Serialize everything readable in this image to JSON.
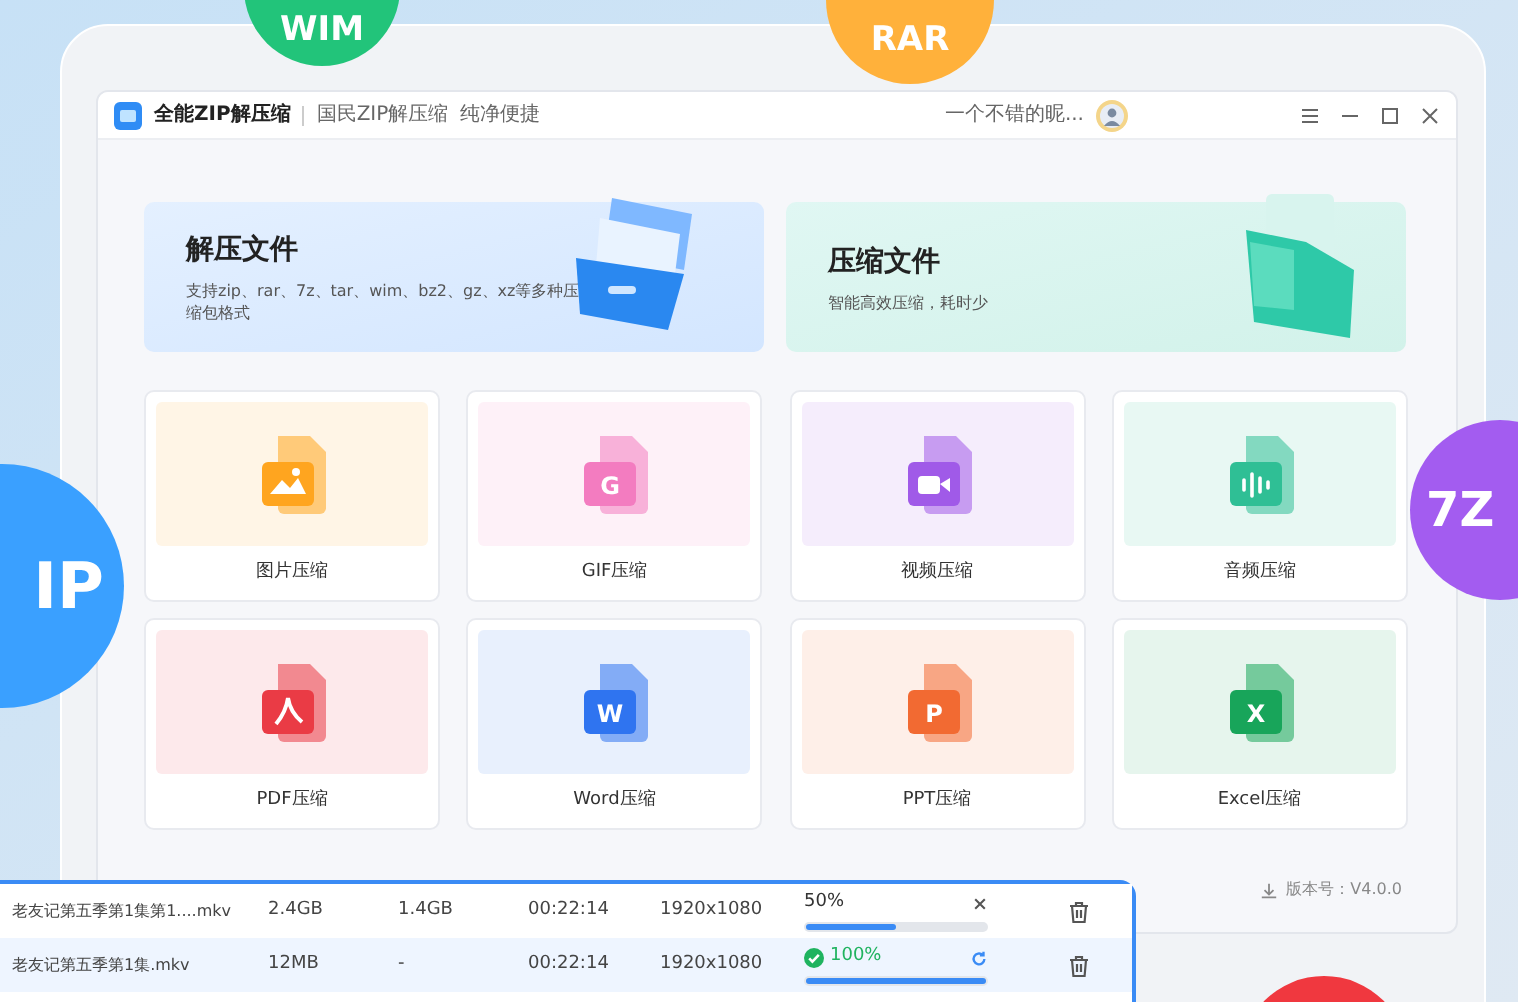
{
  "badges": [
    {
      "text": "WIM",
      "color": "#22c47a",
      "kind": "top_left"
    },
    {
      "text": "RAR",
      "color": "#ffb13b",
      "kind": "top_right"
    },
    {
      "text": "IP",
      "color": "#3aa0ff",
      "kind": "left"
    },
    {
      "text": "7Z",
      "color": "#a35cf0",
      "kind": "right"
    },
    {
      "color": "#f0383f",
      "kind": "bottom"
    }
  ],
  "window": {
    "app_name": "全能ZIP解压缩",
    "slogan": [
      "国民ZIP解压缩",
      "纯净便捷"
    ],
    "user_name": "一个不错的昵..."
  },
  "hero_cards": [
    {
      "kind": "extract",
      "title": "解压文件",
      "description": "支持zip、rar、7z、tar、wim、bz2、gz、xz等多种压缩包格式"
    },
    {
      "kind": "compress",
      "title": "压缩文件",
      "description": "智能高效压缩，耗时少"
    }
  ],
  "tools": [
    {
      "kind": "image",
      "label": "图片压缩",
      "color": "#ffa51f"
    },
    {
      "kind": "gif",
      "label": "GIF压缩",
      "glyph": "G",
      "color": "#f37cc0"
    },
    {
      "kind": "video",
      "label": "视频压缩",
      "color": "#a05ae8"
    },
    {
      "kind": "audio",
      "label": "音频压缩",
      "color": "#2fbf95"
    },
    {
      "kind": "pdf",
      "label": "PDF压缩",
      "color": "#ea3b45"
    },
    {
      "kind": "word",
      "label": "Word压缩",
      "glyph": "W",
      "color": "#2f74f0"
    },
    {
      "kind": "ppt",
      "label": "PPT压缩",
      "glyph": "P",
      "color": "#f26a32"
    },
    {
      "kind": "excel",
      "label": "Excel压缩",
      "glyph": "X",
      "color": "#18a55a"
    }
  ],
  "version": "版本号：V4.0.0",
  "files": [
    {
      "name": "老友记第五季第1集第1....mkv",
      "size": "2.4GB",
      "compressed": "1.4GB",
      "duration": "00:22:14",
      "resolution": "1920x1080",
      "progress": "50%",
      "level": 0.5,
      "done": false,
      "selected": false
    },
    {
      "name": "老友记第五季第1集.mkv",
      "size": "12MB",
      "compressed": "-",
      "duration": "00:22:14",
      "resolution": "1920x1080",
      "progress": "100%",
      "level": 1,
      "done": true,
      "selected": true
    }
  ]
}
